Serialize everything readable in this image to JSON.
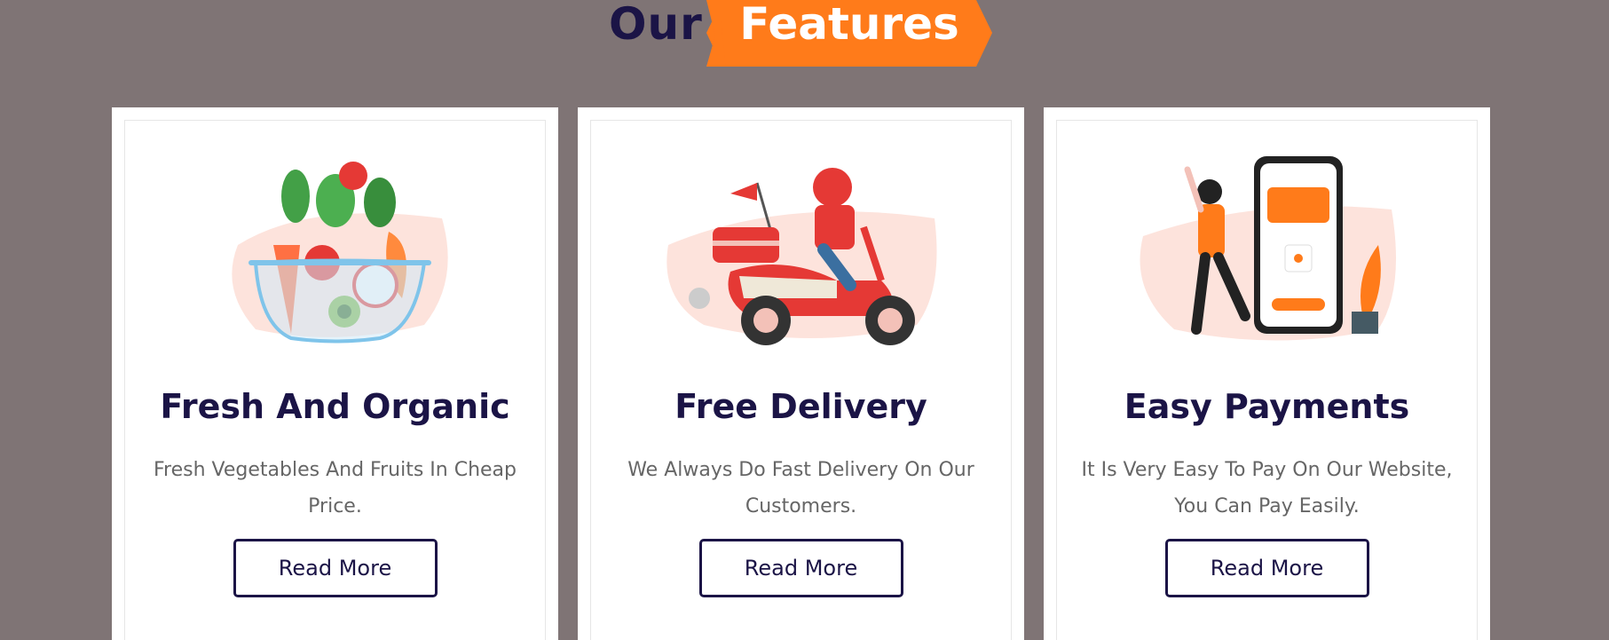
{
  "heading": {
    "prefix": "Our",
    "highlight": "Features"
  },
  "colors": {
    "background": "#7f7475",
    "accent": "#ff7b1a",
    "heading": "#1b1446",
    "card": "#ffffff"
  },
  "features": [
    {
      "illustration": "vegetable-bowl-illustration",
      "title": "Fresh And Organic",
      "line1": "Fresh Vegetables And Fruits In Cheap",
      "line2": "Price.",
      "button": "Read More"
    },
    {
      "illustration": "delivery-scooter-illustration",
      "title": "Free Delivery",
      "line1": "We Always Do Fast Delivery On Our",
      "line2": "Customers.",
      "button": "Read More"
    },
    {
      "illustration": "mobile-payment-illustration",
      "title": "Easy Payments",
      "line1": "It Is Very Easy To Pay On Our Website,",
      "line2": "You Can Pay Easily.",
      "button": "Read More"
    }
  ]
}
